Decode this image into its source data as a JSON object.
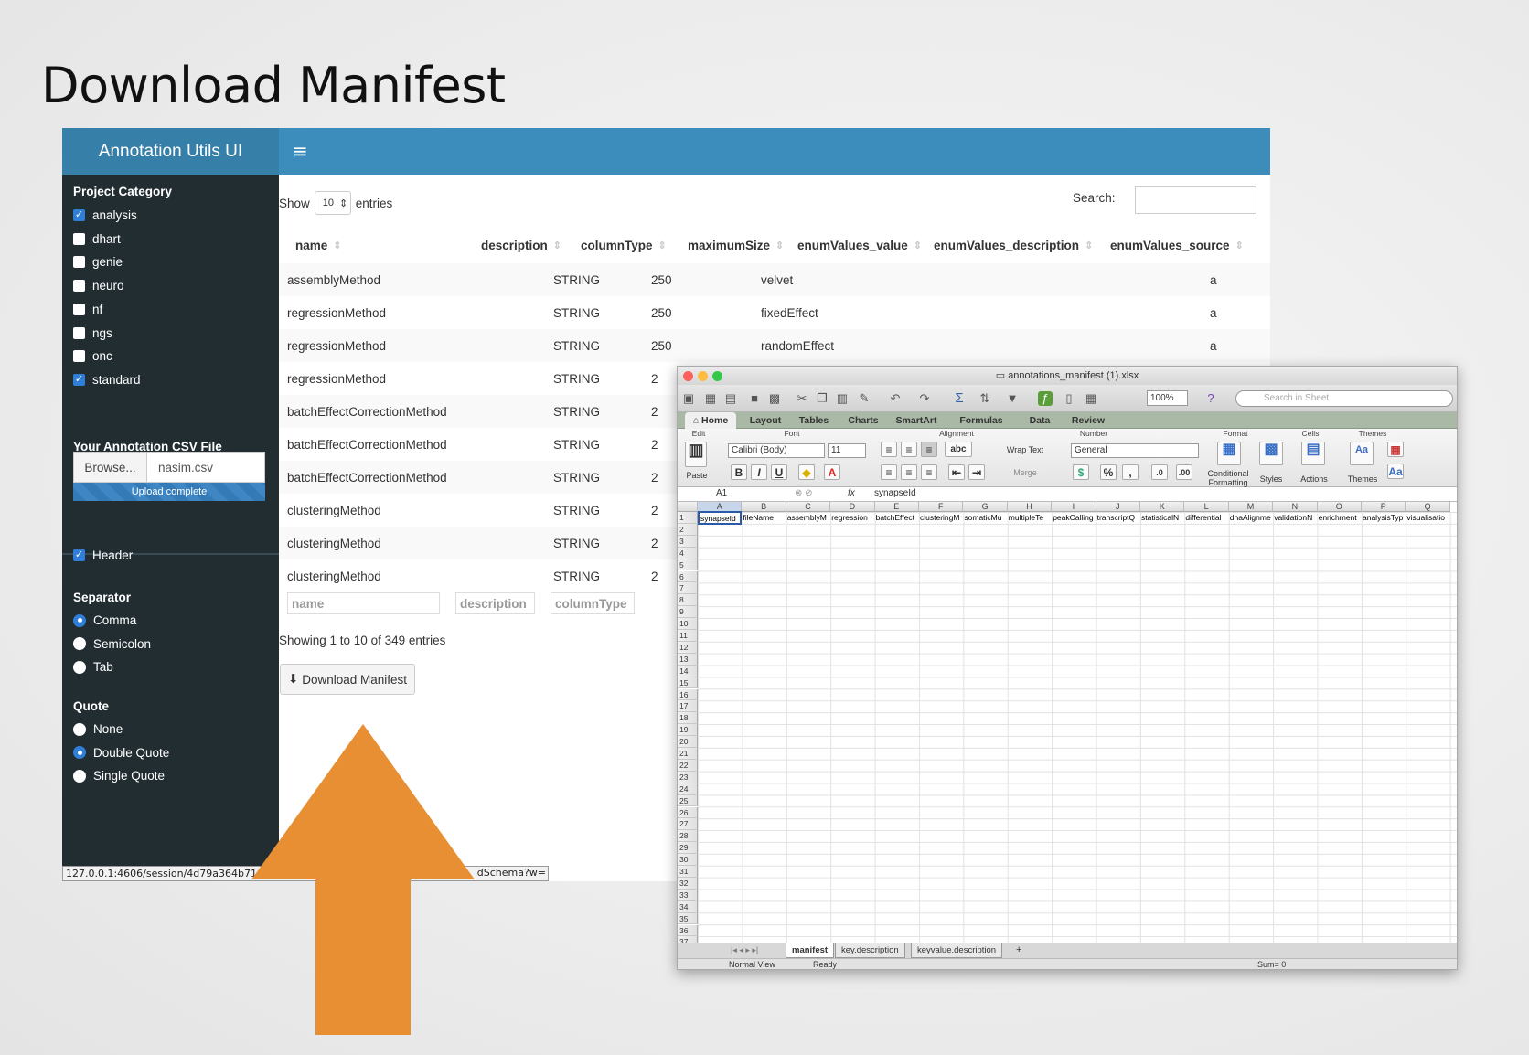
{
  "slide": {
    "title": "Download Manifest"
  },
  "app": {
    "logo": "Annotation Utils UI",
    "menu_icon": "hamburger-icon",
    "sidebar": {
      "project_category_label": "Project Category",
      "categories": [
        {
          "label": "analysis",
          "checked": true
        },
        {
          "label": "dhart",
          "checked": false
        },
        {
          "label": "genie",
          "checked": false
        },
        {
          "label": "neuro",
          "checked": false
        },
        {
          "label": "nf",
          "checked": false
        },
        {
          "label": "ngs",
          "checked": false
        },
        {
          "label": "onc",
          "checked": false
        },
        {
          "label": "standard",
          "checked": true
        }
      ],
      "csv_label": "Your Annotation CSV File",
      "browse": "Browse...",
      "file_name": "nasim.csv",
      "upload_status": "Upload complete",
      "header_label": "Header",
      "separator_label": "Separator",
      "separators": [
        "Comma",
        "Semicolon",
        "Tab"
      ],
      "quote_label": "Quote",
      "quotes": [
        "None",
        "Double Quote",
        "Single Quote"
      ]
    },
    "table": {
      "show": "Show",
      "page_size": "10",
      "entries": "entries",
      "search_label": "Search:",
      "columns": [
        "name",
        "description",
        "columnType",
        "maximumSize",
        "enumValues_value",
        "enumValues_description",
        "enumValues_source"
      ],
      "rows": [
        [
          "assemblyMethod",
          "",
          "STRING",
          "250",
          "velvet",
          "",
          "a"
        ],
        [
          "regressionMethod",
          "",
          "STRING",
          "250",
          "fixedEffect",
          "",
          "a"
        ],
        [
          "regressionMethod",
          "",
          "STRING",
          "250",
          "randomEffect",
          "",
          "a"
        ],
        [
          "regressionMethod",
          "",
          "STRING",
          "2",
          "",
          "",
          ""
        ],
        [
          "batchEffectCorrectionMethod",
          "",
          "STRING",
          "2",
          "",
          "",
          ""
        ],
        [
          "batchEffectCorrectionMethod",
          "",
          "STRING",
          "2",
          "",
          "",
          ""
        ],
        [
          "batchEffectCorrectionMethod",
          "",
          "STRING",
          "2",
          "",
          "",
          ""
        ],
        [
          "clusteringMethod",
          "",
          "STRING",
          "2",
          "",
          "",
          ""
        ],
        [
          "clusteringMethod",
          "",
          "STRING",
          "2",
          "",
          "",
          ""
        ],
        [
          "clusteringMethod",
          "",
          "STRING",
          "2",
          "",
          "",
          ""
        ]
      ],
      "filters": [
        "name",
        "description",
        "columnType"
      ],
      "info": "Showing 1 to 10 of 349 entries",
      "download_button": "Download Manifest"
    },
    "status_url": "127.0.0.1:4606/session/4d79a364b71",
    "status_url_tail": "dSchema?w="
  },
  "excel": {
    "title": "annotations_manifest (1).xlsx",
    "zoom": "100%",
    "search_placeholder": "Search in Sheet",
    "tabs": [
      "Home",
      "Layout",
      "Tables",
      "Charts",
      "SmartArt",
      "Formulas",
      "Data",
      "Review"
    ],
    "groups": [
      "Edit",
      "Font",
      "Alignment",
      "Number",
      "Format",
      "Cells",
      "Themes"
    ],
    "font_name": "Calibri (Body)",
    "font_size": "11",
    "number_format": "General",
    "wrap_text": "Wrap Text",
    "merge": "Merge",
    "paste": "Paste",
    "cond_format": "Conditional Formatting",
    "styles": "Styles",
    "actions": "Actions",
    "themes": "Themes",
    "cell_ref": "A1",
    "formula_value": "synapseId",
    "col_letters": [
      "A",
      "B",
      "C",
      "D",
      "E",
      "F",
      "G",
      "H",
      "I",
      "J",
      "K",
      "L",
      "M",
      "N",
      "O",
      "P",
      "Q"
    ],
    "header_row": [
      "synapseId",
      "fileName",
      "assemblyM",
      "regression",
      "batchEffect",
      "clusteringM",
      "somaticMu",
      "multipleTe",
      "peakCalling",
      "transcriptQ",
      "statisticalN",
      "differential",
      "dnaAlignme",
      "validationN",
      "enrichment",
      "analysisTyp",
      "visualisatio"
    ],
    "row_count": 37,
    "sheets": [
      "manifest",
      "key.description",
      "keyvalue.description"
    ],
    "status_view": "Normal View",
    "status_ready": "Ready",
    "status_sum": "Sum= 0"
  },
  "colors": {
    "header": "#3c8dbc",
    "sidebar": "#222d32",
    "arrow": "#e78f32"
  }
}
